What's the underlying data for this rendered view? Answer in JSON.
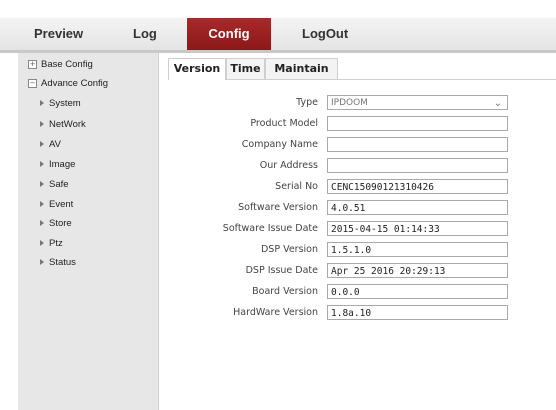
{
  "nav": {
    "preview": "Preview",
    "log": "Log",
    "config": "Config",
    "logout": "LogOut"
  },
  "sidebar": {
    "base_config": "Base Config",
    "advance_config": "Advance Config",
    "items": [
      "System",
      "NetWork",
      "AV",
      "Image",
      "Safe",
      "Event",
      "Store",
      "Ptz",
      "Status"
    ]
  },
  "tabs": [
    "Version",
    "Time",
    "Maintain"
  ],
  "form": {
    "type": {
      "label": "Type",
      "value": "IPDOOM"
    },
    "product_model": {
      "label": "Product Model",
      "value": ""
    },
    "company_name": {
      "label": "Company Name",
      "value": ""
    },
    "our_address": {
      "label": "Our Address",
      "value": ""
    },
    "serial_no": {
      "label": "Serial No",
      "value": "CENC15090121310426"
    },
    "software_version": {
      "label": "Software Version",
      "value": "4.0.51"
    },
    "software_issue_date": {
      "label": "Software Issue Date",
      "value": "2015-04-15 01:14:33"
    },
    "dsp_version": {
      "label": "DSP Version",
      "value": "1.5.1.0"
    },
    "dsp_issue_date": {
      "label": "DSP Issue Date",
      "value": "Apr 25 2016 20:29:13"
    },
    "board_version": {
      "label": "Board Version",
      "value": "0.0.0"
    },
    "hardware_version": {
      "label": "HardWare Version",
      "value": "1.8a.10"
    }
  },
  "icons": {
    "expand": "plus-box-icon",
    "collapse": "minus-box-icon",
    "tree_item": "triangle-right-icon",
    "dropdown": "chevron-down-icon"
  },
  "colors": {
    "active_tab": "#9a2020",
    "nav_bg": "#e8e8e8",
    "sidebar_bg": "#e7e7e7"
  }
}
